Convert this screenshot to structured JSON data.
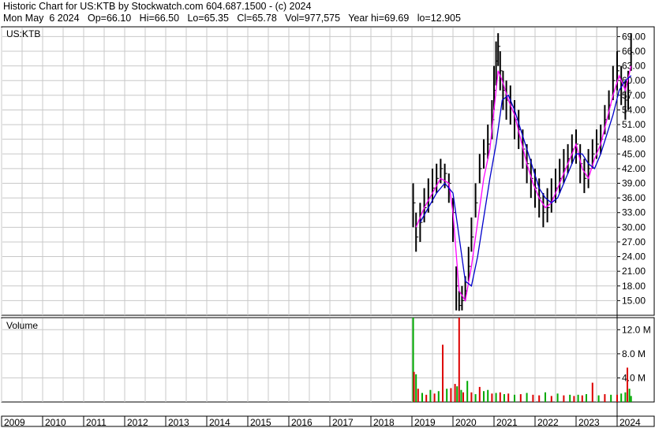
{
  "header": {
    "line1": "Historic Chart for US:KTB by Stockwatch.com 604.687.1500 - (c) 2024",
    "line2": "Mon May  6 2024   Op=66.10   Hi=66.50   Lo=65.35   Cl=65.78   Vol=977,575   Year hi=69.69   lo=12.905"
  },
  "colors": {
    "background": "#ffffff",
    "grid": "#c8c8c8",
    "frame": "#000000",
    "price_bars": "#000000",
    "ma_short": "#ff00ff",
    "ma_long": "#0000cc",
    "volume_up": "#00aa00",
    "volume_down": "#dd0000"
  },
  "chart_data": [
    {
      "type": "line",
      "panel": "price",
      "label": "US:KTB",
      "x_unit": "year",
      "ylim": [
        12,
        71
      ],
      "y_ticks": [
        15,
        18,
        21,
        24,
        27,
        30,
        33,
        36,
        39,
        42,
        45,
        48,
        51,
        54,
        57,
        60,
        63,
        66,
        69
      ],
      "y_tick_labels": [
        "15.00",
        "18.00",
        "21.00",
        "24.00",
        "27.00",
        "30.00",
        "33.00",
        "36.00",
        "39.00",
        "42.00",
        "45.00",
        "48.00",
        "51.00",
        "54.00",
        "57.00",
        "60.00",
        "63.00",
        "66.00",
        "69.00"
      ],
      "grid": true,
      "series": [
        {
          "role": "price",
          "x": [
            2019.03,
            2019.1,
            2019.2,
            2019.3,
            2019.4,
            2019.5,
            2019.6,
            2019.7,
            2019.8,
            2019.9,
            2020.0,
            2020.08,
            2020.15,
            2020.22,
            2020.3,
            2020.38,
            2020.45,
            2020.55,
            2020.65,
            2020.75,
            2020.85,
            2020.95,
            2021.0,
            2021.05,
            2021.1,
            2021.15,
            2021.22,
            2021.3,
            2021.4,
            2021.5,
            2021.6,
            2021.7,
            2021.8,
            2021.9,
            2022.0,
            2022.1,
            2022.2,
            2022.3,
            2022.4,
            2022.5,
            2022.6,
            2022.7,
            2022.8,
            2022.9,
            2023.0,
            2023.1,
            2023.2,
            2023.3,
            2023.4,
            2023.5,
            2023.6,
            2023.7,
            2023.8,
            2023.9,
            2024.0,
            2024.1,
            2024.2,
            2024.27,
            2024.34
          ],
          "y": [
            35,
            28,
            31,
            34,
            36,
            38,
            40,
            42,
            41,
            39,
            33,
            18,
            14,
            15,
            17,
            22,
            28,
            35,
            42,
            45,
            47,
            52,
            58,
            64,
            67,
            62,
            58,
            56,
            55,
            52,
            50,
            46,
            43,
            40,
            38,
            36,
            33,
            34,
            36,
            38,
            40,
            42,
            44,
            46,
            47,
            43,
            40,
            42,
            45,
            47,
            48,
            52,
            55,
            60,
            62,
            59,
            56,
            58,
            65.78
          ],
          "high": [
            39,
            33,
            35,
            38,
            40,
            42,
            43,
            44,
            43,
            41,
            36,
            22,
            17,
            18,
            20,
            26,
            32,
            39,
            45,
            48,
            51,
            56,
            63,
            68,
            69.69,
            66,
            62,
            60,
            59,
            56,
            54,
            50,
            47,
            44,
            42,
            40,
            37,
            38,
            40,
            42,
            44,
            46,
            47,
            49,
            50,
            47,
            44,
            46,
            48,
            50,
            51,
            55,
            58,
            63,
            66,
            63,
            60,
            62,
            69.69
          ],
          "low": [
            30,
            25,
            27,
            31,
            33,
            35,
            37,
            39,
            38,
            35,
            27,
            13,
            12.905,
            13,
            15,
            19,
            25,
            32,
            39,
            42,
            44,
            48,
            54,
            59,
            63,
            58,
            54,
            52,
            51,
            48,
            46,
            42,
            39,
            36,
            34,
            32,
            30,
            31,
            33,
            35,
            37,
            39,
            41,
            43,
            43,
            39,
            37,
            38,
            42,
            44,
            45,
            49,
            52,
            56,
            58,
            55,
            52,
            54,
            62
          ]
        },
        {
          "role": "moving-average-short",
          "x": [
            2019.1,
            2019.3,
            2019.5,
            2019.7,
            2019.9,
            2020.0,
            2020.15,
            2020.3,
            2020.45,
            2020.6,
            2020.75,
            2020.9,
            2021.0,
            2021.1,
            2021.2,
            2021.35,
            2021.5,
            2021.65,
            2021.8,
            2021.95,
            2022.1,
            2022.25,
            2022.4,
            2022.55,
            2022.7,
            2022.85,
            2023.0,
            2023.15,
            2023.3,
            2023.45,
            2023.6,
            2023.75,
            2023.9,
            2024.05,
            2024.2,
            2024.34
          ],
          "y": [
            30,
            34,
            37,
            40,
            39,
            33,
            17,
            15,
            22,
            31,
            40,
            46,
            54,
            62,
            60,
            56,
            53,
            48,
            43,
            39,
            36,
            34,
            35,
            38,
            41,
            44,
            47,
            42,
            40,
            44,
            47,
            52,
            57,
            61,
            58,
            63
          ]
        },
        {
          "role": "moving-average-long",
          "x": [
            2019.2,
            2019.4,
            2019.6,
            2019.8,
            2020.0,
            2020.15,
            2020.3,
            2020.45,
            2020.6,
            2020.75,
            2020.9,
            2021.05,
            2021.2,
            2021.35,
            2021.5,
            2021.65,
            2021.8,
            2021.95,
            2022.1,
            2022.25,
            2022.4,
            2022.55,
            2022.7,
            2022.85,
            2023.0,
            2023.15,
            2023.3,
            2023.45,
            2023.6,
            2023.75,
            2023.9,
            2024.05,
            2024.2,
            2024.34
          ],
          "y": [
            31,
            34,
            37,
            39,
            37,
            28,
            19,
            18,
            24,
            32,
            40,
            47,
            56,
            57,
            54,
            50,
            46,
            42,
            38,
            36,
            35,
            36,
            39,
            42,
            45,
            45,
            43,
            42,
            45,
            49,
            53,
            58,
            60,
            61
          ]
        }
      ]
    },
    {
      "type": "bar",
      "panel": "volume",
      "label": "Volume",
      "x_unit": "year",
      "ylim": [
        0,
        14
      ],
      "y_ticks": [
        4,
        8,
        12
      ],
      "y_tick_labels": [
        "4.0 M",
        "8.0 M",
        "12.0 M"
      ],
      "grid": true,
      "x": [
        2019.03,
        2019.05,
        2019.1,
        2019.15,
        2019.25,
        2019.35,
        2019.45,
        2019.55,
        2019.65,
        2019.75,
        2019.85,
        2019.95,
        2020.05,
        2020.1,
        2020.15,
        2020.2,
        2020.25,
        2020.35,
        2020.45,
        2020.55,
        2020.65,
        2020.75,
        2020.85,
        2020.95,
        2021.05,
        2021.15,
        2021.25,
        2021.35,
        2021.5,
        2021.65,
        2021.8,
        2021.95,
        2022.1,
        2022.25,
        2022.4,
        2022.55,
        2022.7,
        2022.85,
        2022.95,
        2023.05,
        2023.15,
        2023.25,
        2023.4,
        2023.55,
        2023.7,
        2023.85,
        2024.0,
        2024.1,
        2024.2,
        2024.25,
        2024.3,
        2024.34
      ],
      "values": [
        14,
        5,
        4.6,
        2.2,
        1.5,
        1.2,
        2.0,
        1.4,
        1.8,
        9.5,
        2.2,
        2.3,
        3.0,
        2.6,
        14,
        2.0,
        1.6,
        3.5,
        1.6,
        1.3,
        2.5,
        1.8,
        2.0,
        1.4,
        1.5,
        1.6,
        1.3,
        1.4,
        1.2,
        1.3,
        1.5,
        1.2,
        1.1,
        1.6,
        1.0,
        1.4,
        1.1,
        1.2,
        1.0,
        1.2,
        1.1,
        1.3,
        3.2,
        1.1,
        1.3,
        1.2,
        1.2,
        1.4,
        1.6,
        5.7,
        2.2,
        1.0
      ],
      "up": [
        true,
        false,
        true,
        false,
        true,
        false,
        true,
        false,
        true,
        false,
        true,
        false,
        false,
        true,
        false,
        true,
        false,
        true,
        false,
        true,
        false,
        true,
        true,
        false,
        true,
        false,
        true,
        false,
        true,
        false,
        true,
        false,
        false,
        true,
        false,
        true,
        false,
        true,
        false,
        true,
        false,
        true,
        false,
        true,
        false,
        true,
        false,
        true,
        true,
        false,
        true,
        true
      ]
    }
  ],
  "x_axis": {
    "labels": [
      "2009",
      "2010",
      "2011",
      "2012",
      "2013",
      "2014",
      "2015",
      "2016",
      "2017",
      "2018",
      "2019",
      "2020",
      "2021",
      "2022",
      "2023",
      "2024"
    ]
  }
}
